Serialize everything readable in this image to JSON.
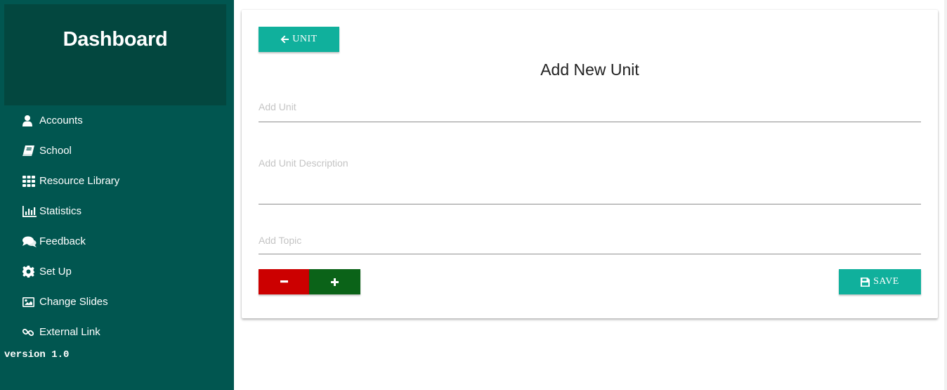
{
  "sidebar": {
    "brand_title": "Dashboard",
    "items": [
      {
        "label": "Accounts",
        "icon": "user-icon"
      },
      {
        "label": "School",
        "icon": "book-icon"
      },
      {
        "label": "Resource Library",
        "icon": "grid-icon"
      },
      {
        "label": "Statistics",
        "icon": "bar-chart-icon"
      },
      {
        "label": "Feedback",
        "icon": "comments-icon"
      },
      {
        "label": "Set Up",
        "icon": "gear-icon"
      },
      {
        "label": "Change Slides",
        "icon": "image-icon"
      },
      {
        "label": "External Link",
        "icon": "link-icon"
      }
    ],
    "version": "version 1.0"
  },
  "form": {
    "back_label": "UNIT",
    "title": "Add New Unit",
    "unit_placeholder": "Add Unit",
    "unit_value": "",
    "description_placeholder": "Add Unit Description",
    "description_value": "",
    "topic_placeholder": "Add Topic",
    "topic_value": "",
    "minus_label": "−",
    "plus_label": "+",
    "save_label": "SAVE"
  },
  "colors": {
    "sidebar_bg": "#015650",
    "brand_bg": "#03473f",
    "accent": "#10b09c",
    "minus": "#cc0000",
    "plus": "#0b6318"
  }
}
